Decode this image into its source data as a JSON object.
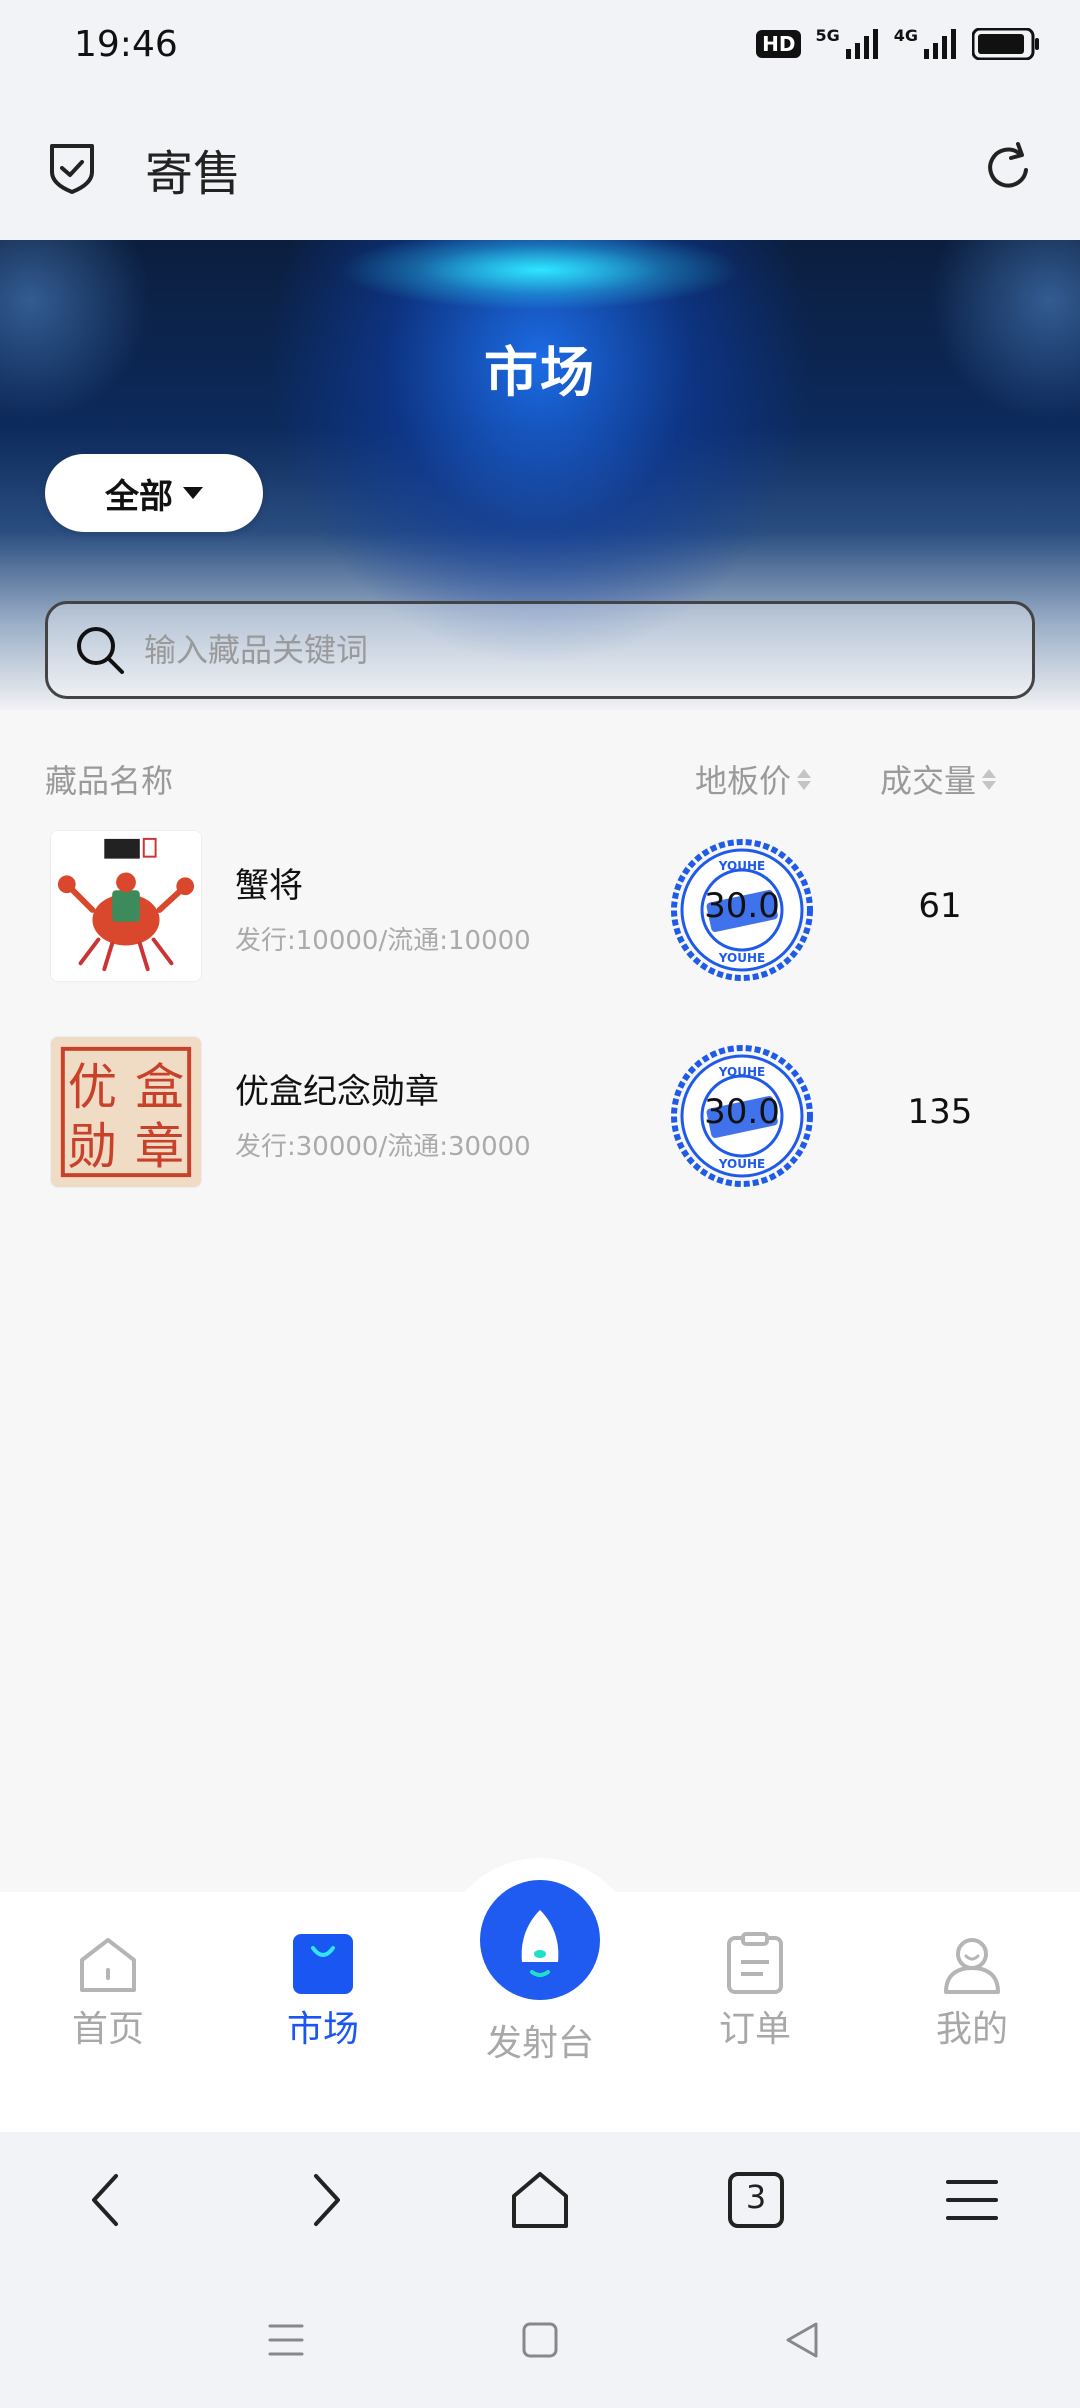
{
  "status": {
    "time": "19:46",
    "hd": "HD",
    "net1": "5G",
    "net2": "4G"
  },
  "header": {
    "title": "寄售"
  },
  "hero": {
    "title": "市场",
    "filter_label": "全部"
  },
  "search": {
    "placeholder": "输入藏品关键词"
  },
  "table": {
    "col_name": "藏品名称",
    "col_floor": "地板价",
    "col_volume": "成交量",
    "rows": [
      {
        "name": "蟹将",
        "sub": "发行:10000/流通:10000",
        "price": "30.0",
        "volume": "61"
      },
      {
        "name": "优盒纪念勋章",
        "sub": "发行:30000/流通:30000",
        "price": "30.0",
        "volume": "135"
      }
    ]
  },
  "medal_text": [
    "优",
    "盒",
    "勋",
    "章"
  ],
  "stamp_text": "YOUHE",
  "tabs": {
    "home": "首页",
    "market": "市场",
    "launch": "发射台",
    "orders": "订单",
    "mine": "我的"
  },
  "browser": {
    "tab_count": "3"
  },
  "colors": {
    "accent": "#1a57f2",
    "stamp": "#1f5be8",
    "launch": "#1f5bf0"
  }
}
